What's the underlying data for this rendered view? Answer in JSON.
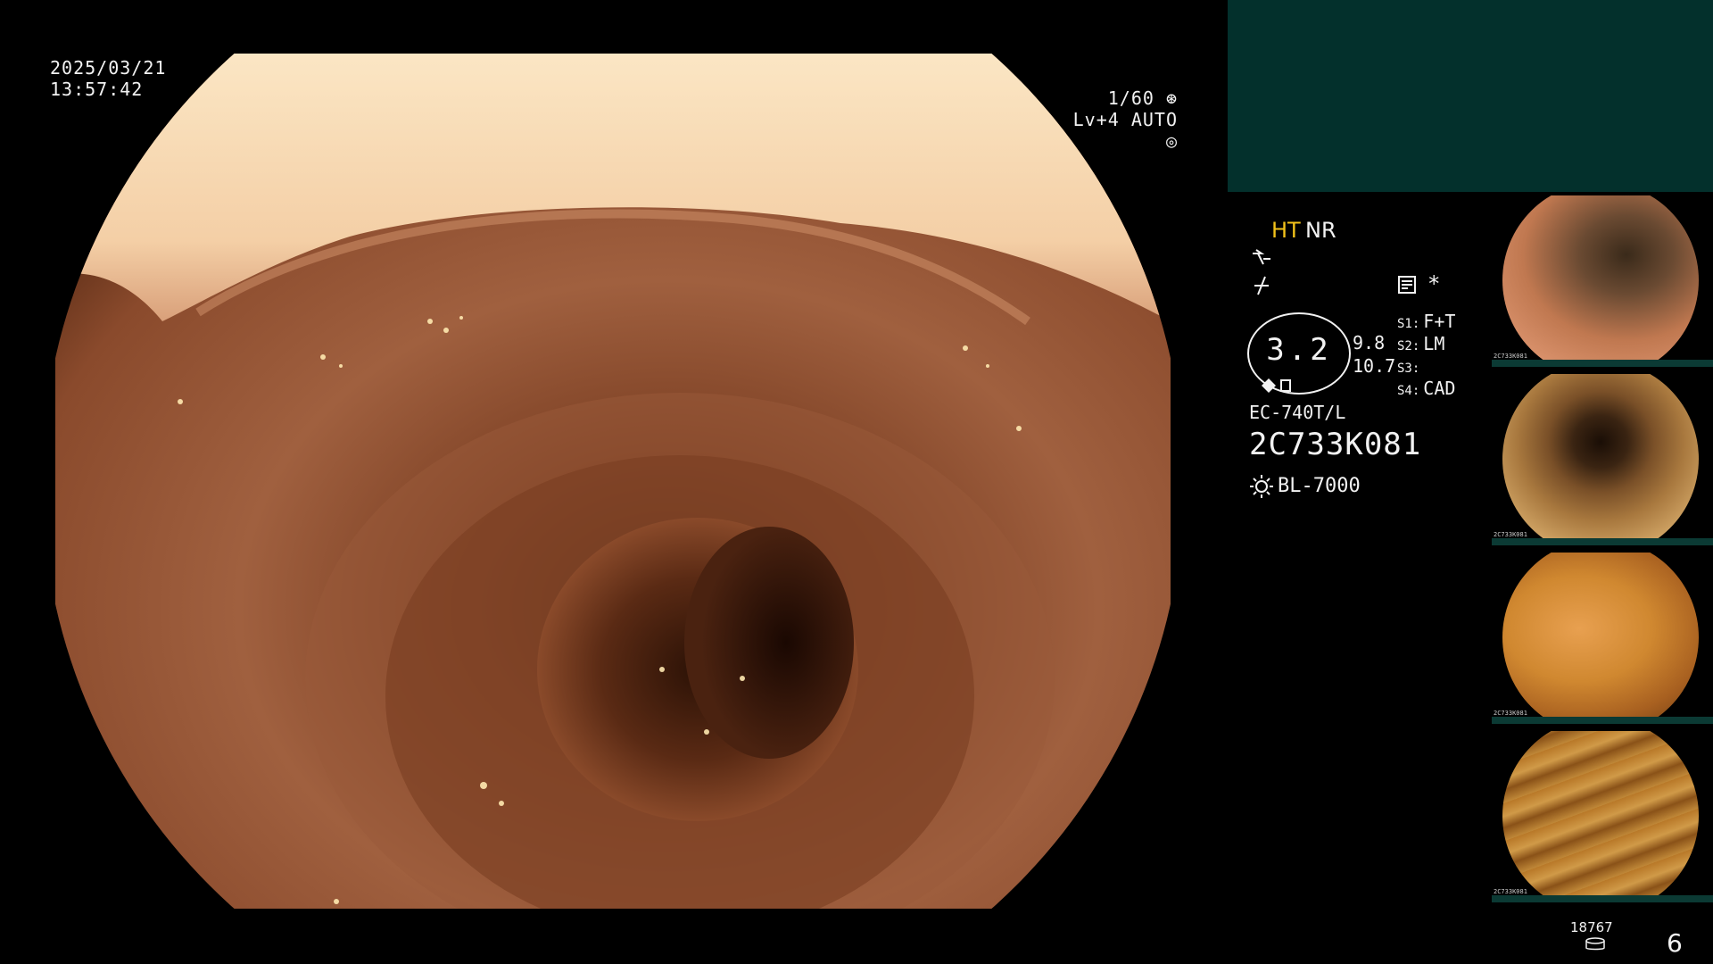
{
  "overlay": {
    "date": "2025/03/21",
    "time": "13:57:42",
    "shutter": "1/60",
    "level": "Lv+4 AUTO"
  },
  "info_panel": {
    "ht_label": "HT",
    "nr_label": "NR",
    "asterisk": "*",
    "zoom_value": "3.2",
    "value_a": "9.8",
    "value_b": "10.7",
    "scopes": [
      {
        "tag": "S1:",
        "value": "F+T"
      },
      {
        "tag": "S2:",
        "value": "LM"
      },
      {
        "tag": "S3:",
        "value": ""
      },
      {
        "tag": "S4:",
        "value": "CAD"
      }
    ],
    "model": "EC-740T/L",
    "serial": "2C733K081",
    "light_source": "BL-7000"
  },
  "thumbnails": [
    {
      "label": "2C733K081"
    },
    {
      "label": "2C733K081"
    },
    {
      "label": "2C733K081"
    },
    {
      "label": "2C733K081"
    }
  ],
  "footer": {
    "counter": "18767",
    "page_number": "6"
  },
  "colors": {
    "accent_yellow": "#f2c21a",
    "panel_teal": "#03302c",
    "text": "#f2f2f2"
  },
  "icons": [
    "aperture-icon",
    "iris-icon",
    "enhance-icon",
    "structure-icon",
    "document-icon",
    "light-source-icon",
    "disk-icon"
  ]
}
